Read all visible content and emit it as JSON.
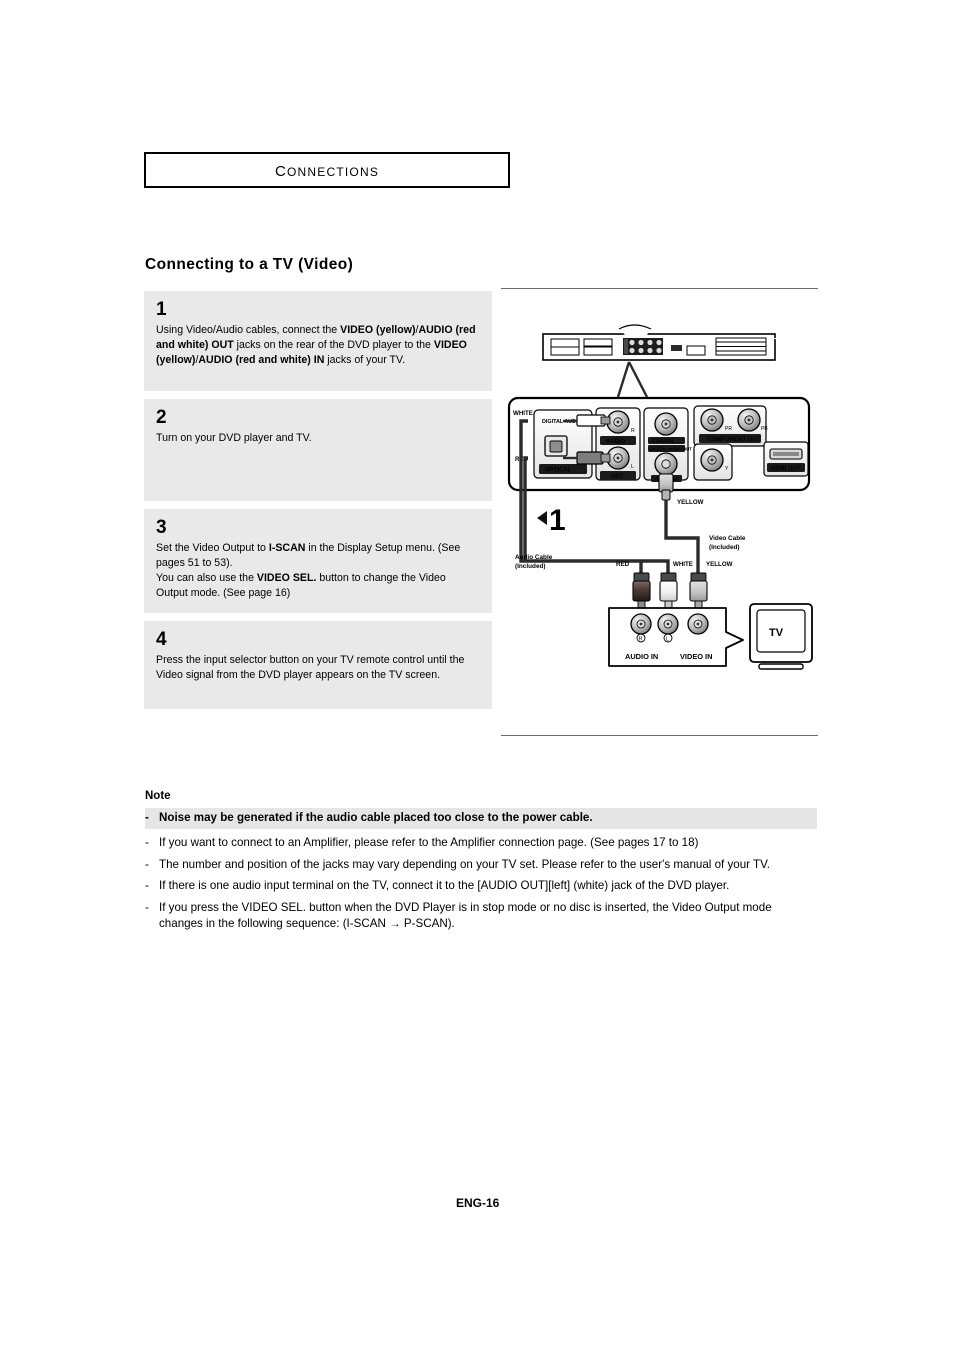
{
  "chapter": {
    "title": "Connections"
  },
  "section": {
    "title": "Connecting to a TV (Video)"
  },
  "steps": [
    {
      "number": "1",
      "parts": [
        {
          "text": "Using Video/Audio cables, connect the ",
          "bold": false
        },
        {
          "text": "VIDEO (yellow)",
          "bold": true
        },
        {
          "text": "/",
          "bold": false
        },
        {
          "text": "AUDIO (red and white) OUT",
          "bold": true
        },
        {
          "text": " jacks on the rear of the DVD player to the ",
          "bold": false
        },
        {
          "text": "VIDEO (yellow)",
          "bold": true
        },
        {
          "text": "/",
          "bold": false
        },
        {
          "text": "AUDIO (red and white) IN",
          "bold": true
        },
        {
          "text": " jacks of your TV.",
          "bold": false
        }
      ]
    },
    {
      "number": "2",
      "parts": [
        {
          "text": "Turn on your DVD player and TV.",
          "bold": false
        }
      ]
    },
    {
      "number": "3",
      "parts": [
        {
          "text": "Set the Video Output to ",
          "bold": false
        },
        {
          "text": "I-SCAN",
          "bold": true
        },
        {
          "text": " in the Display Setup menu. (See pages 51 to 53).",
          "bold": false
        },
        {
          "text": "\n",
          "bold": false
        },
        {
          "text": "You can also use the ",
          "bold": false
        },
        {
          "text": "VIDEO SEL.",
          "bold": true
        },
        {
          "text": " button to change the Video Output mode. (See page 16)",
          "bold": false
        }
      ]
    },
    {
      "number": "4",
      "parts": [
        {
          "text": "Press the input selector button on your TV remote control until the Video signal from the DVD player appears on the TV screen.",
          "bold": false
        }
      ]
    }
  ],
  "diagram": {
    "step_marker": "1",
    "rear_panel_labels": {
      "white": "WHITE",
      "red": "RED",
      "digital_audio_out": "DIGITAL AUDIO OUT",
      "optical": "OPTICAL",
      "audio": "AUDIO",
      "out": "OUT",
      "coaxial": "COAXIAL",
      "video_out": "VIDEO OUT",
      "component_out": "COMPONENT OUT",
      "hdmi_out": "HDMI OUT",
      "jack_r": "R",
      "jack_l": "L",
      "jack_pr": "PR",
      "jack_pb": "PB",
      "jack_y": "Y"
    },
    "cable_labels": {
      "yellow_top": "YELLOW",
      "video_cable": "Video Cable",
      "video_cable_included": "(Included)",
      "audio_cable": "Audio Cable",
      "audio_cable_included": "(Included)",
      "red": "RED",
      "white": "WHITE",
      "yellow": "YELLOW"
    },
    "tv_labels": {
      "audio_in": "AUDIO IN",
      "video_in": "VIDEO IN",
      "right": "R",
      "left": "L",
      "tv": "TV"
    }
  },
  "note": {
    "heading": "Note",
    "items": [
      {
        "dash": "-",
        "text": "Noise may be generated if the audio cable placed too close to the power cable.",
        "highlight": true
      },
      {
        "dash": "-",
        "text": "If you want to connect to an Amplifier, please refer to the Amplifier connection page. (See pages 17 to 18)",
        "highlight": false
      },
      {
        "dash": "-",
        "text": "The number and position of the jacks may vary depending on your TV set. Please refer to the user's manual of your TV.",
        "highlight": false
      },
      {
        "dash": "-",
        "text": "If there is one audio input terminal on the TV, connect it to the [AUDIO OUT][left] (white) jack of the DVD player.",
        "highlight": false
      },
      {
        "dash": "-",
        "text": "If you press the VIDEO SEL. button when the DVD Player is in stop mode or no disc is inserted, the Video Output mode changes in the following sequence: (I-SCAN → P-SCAN).",
        "highlight": false
      }
    ]
  },
  "footer": {
    "page": "ENG-16"
  }
}
